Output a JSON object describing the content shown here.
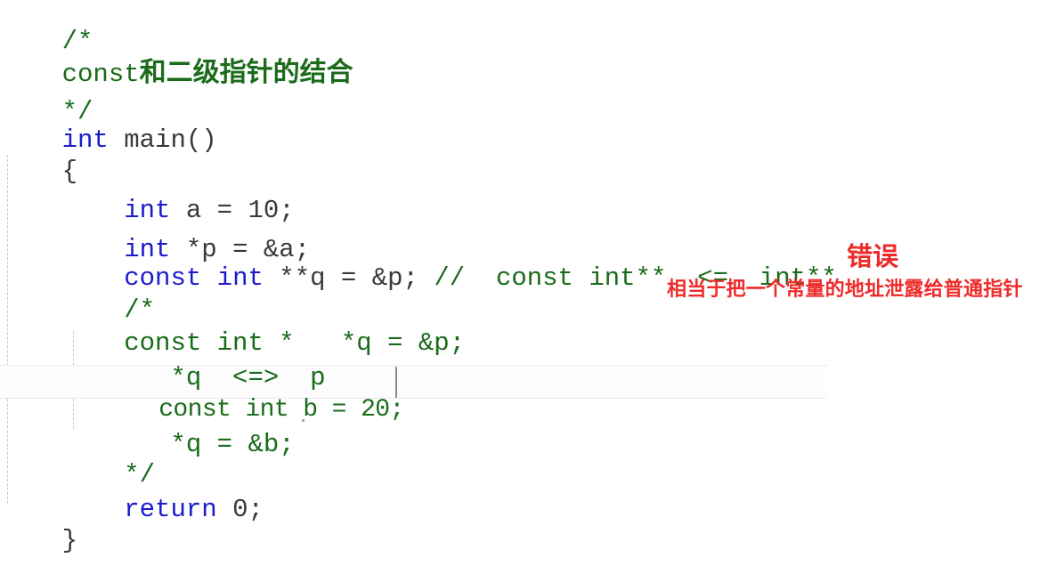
{
  "editor": {
    "background_color": "#ffffff",
    "comment_color": "#1a6b1a",
    "keyword_color": "#1c1ccc",
    "plain_color": "#3a3a3a",
    "annotation_color": "#ee2b2b",
    "active_line_border_color": "#e9e9f2",
    "indent_guide_color": "#c9c9c9"
  },
  "code": {
    "line_01": "/*",
    "line_02_latin": "const",
    "line_02_cjk": "和二级指针的结合",
    "line_03": "*/",
    "line_04_kw": "int",
    "line_04_rest": " main()",
    "line_05": "{",
    "line_06_indent": "    ",
    "line_06_kw": "int",
    "line_06_rest": " a = 10;",
    "line_07_indent": "    ",
    "line_07_kw": "int",
    "line_07_rest": " *p = &a;",
    "line_08_indent": "    ",
    "line_08_kw1": "const int",
    "line_08_rest": " **q = &p; ",
    "line_08_comment": "//  const int**  <=  int**",
    "line_09": "    /*",
    "line_10": "    const int *   *q = &p;",
    "line_11": "       *q  <=>  p",
    "line_12": "       const int b = 20;",
    "line_13": "       *q = &b;",
    "line_14": "    */",
    "line_15_indent": "    ",
    "line_15_kw": "return",
    "line_15_rest": " 0;",
    "line_16": "}"
  },
  "annotations": {
    "error_label": "错误",
    "note_text": "相当于把一个常量的地址泄露给普通指针"
  },
  "caret": {
    "line": "const int b = 20;",
    "column_after": ";"
  }
}
